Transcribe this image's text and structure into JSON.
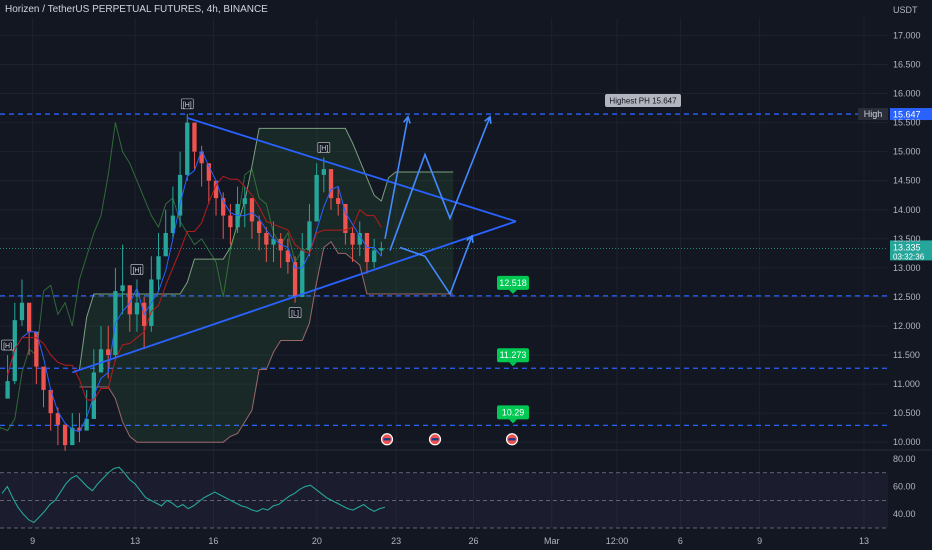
{
  "header": {
    "title": "Horizen / TetherUS PERPETUAL FUTURES, 4h, BINANCE"
  },
  "axis": {
    "currency": "USDT"
  },
  "colors": {
    "background": "#131722",
    "bull": "#26a69a",
    "bear": "#ef5350",
    "pattern": "#2962ff",
    "level": "#2962ff",
    "rsi": "#26a69a",
    "tenkan": "#2962ff",
    "kijun": "#b71c1c"
  },
  "chart_data": [
    {
      "type": "candlestick",
      "title": "Horizen / TetherUS PERPETUAL FUTURES, 4h, BINANCE",
      "y_unit": "USDT",
      "ylim": [
        9.9,
        17.3
      ],
      "y_ticks": [
        "17.000",
        "16.500",
        "16.000",
        "15.500",
        "15.000",
        "14.500",
        "14.000",
        "13.500",
        "13.000",
        "12.500",
        "12.000",
        "11.500",
        "11.000",
        "10.500",
        "10.000"
      ],
      "y_tick_values": [
        17.0,
        16.5,
        16.0,
        15.5,
        15.0,
        14.5,
        14.0,
        13.5,
        13.0,
        12.5,
        12.0,
        11.5,
        11.0,
        10.5,
        10.0
      ],
      "x_ticks": [
        "9",
        "13",
        "16",
        "20",
        "23",
        "26",
        "Mar",
        "12:00",
        "6",
        "9",
        "13"
      ],
      "x_tick_positions": [
        0.035,
        0.145,
        0.229,
        0.34,
        0.425,
        0.508,
        0.592,
        0.662,
        0.73,
        0.815,
        0.927
      ],
      "data_end_fraction": 0.413,
      "close_series": [
        11.05,
        12.1,
        12.4,
        11.9,
        11.3,
        10.9,
        10.5,
        10.3,
        9.95,
        10.25,
        10.2,
        10.4,
        11.2,
        11.6,
        11.5,
        12.6,
        12.7,
        12.2,
        12.4,
        12.0,
        12.8,
        13.2,
        13.6,
        13.9,
        14.6,
        15.5,
        15.0,
        14.8,
        14.5,
        14.2,
        13.9,
        13.7,
        14.1,
        14.2,
        13.8,
        13.6,
        13.4,
        13.5,
        13.3,
        13.1,
        12.5,
        13.3,
        13.8,
        14.6,
        14.7,
        14.2,
        14.1,
        13.6,
        13.4,
        13.6,
        13.1,
        13.3,
        13.34
      ],
      "high_series": [
        11.5,
        12.4,
        12.8,
        12.3,
        11.6,
        11.1,
        10.8,
        10.6,
        10.3,
        10.5,
        10.5,
        10.9,
        11.6,
        12.0,
        12.0,
        13.0,
        13.4,
        12.7,
        12.8,
        12.5,
        13.2,
        13.6,
        14.0,
        14.4,
        15.0,
        15.65,
        15.4,
        15.1,
        14.8,
        14.5,
        14.3,
        14.1,
        14.4,
        14.4,
        14.2,
        13.9,
        13.7,
        13.8,
        13.6,
        13.5,
        13.2,
        13.6,
        14.1,
        14.8,
        14.9,
        14.5,
        14.4,
        14.0,
        13.7,
        13.8,
        13.5,
        13.5,
        13.45
      ],
      "low_series": [
        10.8,
        11.0,
        12.0,
        11.5,
        11.0,
        10.6,
        10.2,
        9.95,
        9.85,
        9.95,
        10.0,
        10.2,
        10.4,
        11.3,
        11.1,
        11.4,
        12.2,
        11.9,
        11.9,
        11.6,
        11.9,
        12.6,
        13.2,
        13.5,
        13.7,
        14.5,
        14.7,
        14.4,
        14.1,
        13.9,
        13.5,
        13.4,
        13.6,
        13.7,
        13.5,
        13.3,
        13.1,
        13.1,
        13.0,
        12.9,
        12.4,
        12.5,
        13.2,
        13.8,
        14.3,
        14.0,
        13.9,
        13.4,
        13.1,
        13.2,
        12.9,
        13.0,
        13.2
      ],
      "rsi": {
        "ylim": [
          30,
          85
        ],
        "y_ticks": [
          "80.00",
          "60.00",
          "40.00"
        ],
        "y_tick_values": [
          80,
          60,
          40
        ],
        "upper": 70,
        "mid": 50,
        "lower": 30,
        "values": [
          55,
          60,
          52,
          45,
          40,
          36,
          34,
          38,
          42,
          47,
          50,
          56,
          62,
          66,
          68,
          64,
          60,
          57,
          62,
          66,
          70,
          73,
          74,
          70,
          65,
          62,
          57,
          52,
          50,
          48,
          46,
          50,
          48,
          45,
          47,
          44,
          46,
          49,
          52,
          54,
          56,
          54,
          52,
          50,
          48,
          46,
          45,
          43,
          42,
          44,
          43,
          46,
          47,
          50,
          53,
          55,
          58,
          60,
          61,
          58,
          55,
          52,
          50,
          48,
          46,
          44,
          43,
          45,
          47,
          44,
          42,
          44,
          45
        ]
      },
      "levels": [
        {
          "value": 15.647,
          "label": "15.647",
          "tag": "High",
          "callout": "Highest PH 15.647"
        },
        {
          "value": 12.518,
          "label": "12.518"
        },
        {
          "value": 11.273,
          "label": "11.273"
        },
        {
          "value": 10.29,
          "label": "10.29"
        }
      ],
      "last_price": {
        "value": 13.335,
        "label": "13.335",
        "countdown": "03:32:36"
      },
      "pivot_labels": [
        "[H]",
        "[H]",
        "[H]",
        "[H]",
        "[L]"
      ],
      "annotations": [
        "Highest PH 15.647"
      ]
    }
  ]
}
